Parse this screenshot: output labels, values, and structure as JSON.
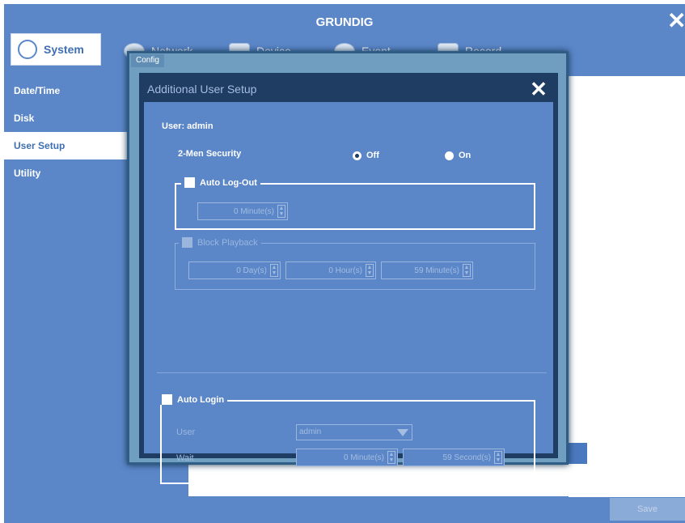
{
  "app": {
    "brand": "GRUNDIG"
  },
  "tabs": [
    {
      "label": "System",
      "icon": "gear-icon"
    },
    {
      "label": "Network",
      "icon": "globe-icon"
    },
    {
      "label": "Device",
      "icon": "hdd-icon"
    },
    {
      "label": "Event",
      "icon": "event-icon"
    },
    {
      "label": "Record",
      "icon": "record-icon"
    }
  ],
  "sidebar": {
    "items": [
      {
        "label": "Date/Time"
      },
      {
        "label": "Disk"
      },
      {
        "label": "User Setup"
      },
      {
        "label": "Utility"
      }
    ]
  },
  "footer": {
    "save_label": "Save"
  },
  "dialog": {
    "window_tab": "Config",
    "title": "Additional User Setup",
    "user_label": "User: admin",
    "security": {
      "label": "2-Men Security",
      "off_label": "Off",
      "on_label": "On",
      "selected": "Off"
    },
    "auto_logout": {
      "label": "Auto Log-Out",
      "minutes": "0 Minute(s)"
    },
    "block_playback": {
      "label": "Block Playback",
      "days": "0 Day(s)",
      "hours": "0 Hour(s)",
      "minutes": "59 Minute(s)"
    },
    "auto_login": {
      "label": "Auto Login",
      "user_label": "User",
      "user_value": "admin",
      "wait_label": "Wait",
      "wait_minutes": "0 Minute(s)",
      "wait_seconds": "59 Second(s)"
    }
  },
  "colors": {
    "background": "#5b87c9",
    "dialog_frame": "#1f3c63",
    "accent_text": "#3e6fb3"
  }
}
